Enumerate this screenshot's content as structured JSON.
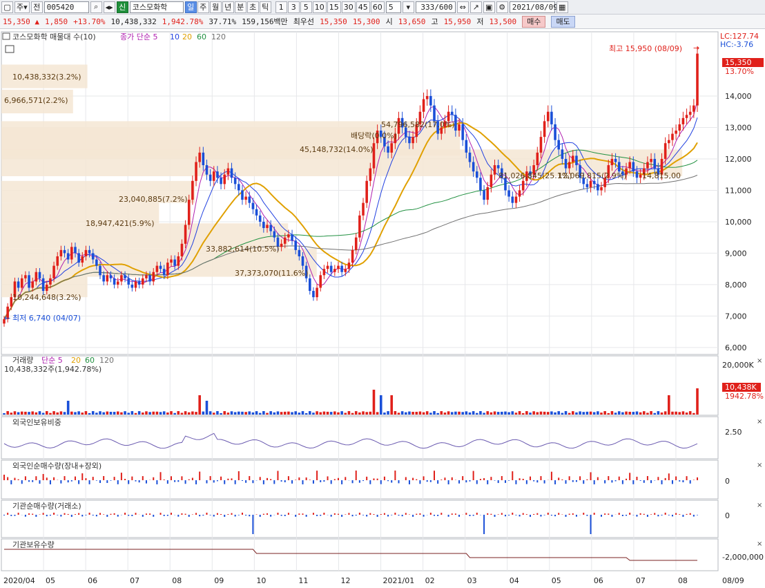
{
  "toolbar": {
    "market": "주",
    "prev": "전",
    "code": "005420",
    "mode_badge": "신",
    "stock_name": "코스모화학",
    "periods": [
      "일",
      "주",
      "월",
      "년",
      "분",
      "초",
      "틱"
    ],
    "active_period": "일",
    "intervals": [
      "1",
      "3",
      "5",
      "10",
      "15",
      "30",
      "45",
      "60"
    ],
    "count_box": "5",
    "range": "333/600",
    "date": "2021/08/09"
  },
  "quote": {
    "price": "15,350",
    "arrow": "▲",
    "change": "1,850",
    "change_pct": "+13.70%",
    "volume": "10,438,332",
    "volume_pct": "1,942.78%",
    "turnover": "37.71%",
    "amount": "159,156백만",
    "best_ask_label": "최우선",
    "best_ask": "15,350",
    "best_bid": "15,300",
    "open_label": "시",
    "open": "13,650",
    "high_label": "고",
    "high": "15,950",
    "low_label": "저",
    "low": "13,500",
    "buy": "매수",
    "sell": "매도"
  },
  "colors": {
    "up": "#e0201a",
    "down": "#1a4fd8",
    "ma5": "#b020b0",
    "ma10": "#2040e0",
    "ma20": "#e0a000",
    "ma60": "#209040",
    "ma120": "#707070",
    "box": "#f5e6d3"
  },
  "price_panel": {
    "legend_title": "코스모화학 매물대 수(10)",
    "legend_ma": "종가 단순 5",
    "legend_periods": [
      "10",
      "20",
      "60",
      "120"
    ],
    "lc": "LC:127.74",
    "hc": "HC:-3.76",
    "high_note": "최고 15,950 (08/09)",
    "low_note": "최저 6,740 (04/07)",
    "last_price": "15,350",
    "last_pct": "13.70%",
    "yticks": [
      "14,000",
      "13,000",
      "12,000",
      "11,000",
      "10,000",
      "9,000",
      "8,000",
      "7,000",
      "6,000"
    ],
    "profile": [
      "10,438,332(3.2%)",
      "6,966,571(2.2%)",
      "54,796,582(17.0%)",
      "배당락(0.0%)",
      "45,148,732(14.0%)",
      "81,026,845(25.1%)",
      "12,069,815(2.9%)",
      "14,815,00",
      "23,040,885(7.2%)",
      "18,947,421(5.9%)",
      "33,882,614(10.5%)",
      "37,373,070(11.6%)",
      "10,244,648(3.2%)"
    ]
  },
  "volume_panel": {
    "title": "거래량",
    "legend_ma": "단순 5",
    "legend_periods": [
      "20",
      "60",
      "120"
    ],
    "sub": "10,438,332주(1,942.78%)",
    "ytick": "20,000K",
    "last": "10,438K",
    "last_pct": "1942.78%"
  },
  "foreign_panel": {
    "title": "외국인보유비중",
    "ytick": "2.50"
  },
  "foreign_net_panel": {
    "title": "외국인순매수량(장내+장외)",
    "ytick": "0"
  },
  "inst_net_panel": {
    "title": "기관순매수량(거래소)",
    "ytick": "0"
  },
  "inst_hold_panel": {
    "title": "기관보유수량",
    "ytick": "-2,000,000"
  },
  "xaxis": [
    "2020/04",
    "05",
    "06",
    "07",
    "08",
    "09",
    "10",
    "11",
    "12",
    "2021/01",
    "02",
    "03",
    "04",
    "05",
    "06",
    "07",
    "08"
  ],
  "xaxis_end": "08/09",
  "chart_data": {
    "type": "candlestick",
    "ylim": [
      5800,
      16000
    ],
    "closes": [
      6900,
      7300,
      7600,
      8100,
      7900,
      8200,
      8300,
      7900,
      8100,
      8400,
      8200,
      7800,
      8000,
      8200,
      8600,
      8900,
      9100,
      9000,
      8800,
      9200,
      9000,
      8700,
      8900,
      9100,
      9000,
      8800,
      8600,
      8300,
      8100,
      8300,
      8200,
      8000,
      8100,
      8300,
      8200,
      8000,
      7900,
      8100,
      8000,
      8200,
      8300,
      8100,
      8400,
      8600,
      8500,
      8300,
      8700,
      8800,
      8600,
      8900,
      9300,
      9900,
      10700,
      11300,
      11900,
      12200,
      11800,
      11500,
      11300,
      11600,
      11400,
      11200,
      11500,
      11700,
      11400,
      11200,
      11000,
      10700,
      10800,
      10600,
      10400,
      10200,
      10000,
      9800,
      9900,
      9700,
      9500,
      9200,
      9300,
      9500,
      9600,
      9400,
      9100,
      8900,
      8600,
      8200,
      7800,
      7600,
      7900,
      8300,
      8500,
      8600,
      8400,
      8500,
      8600,
      8400,
      8500,
      8700,
      9100,
      9500,
      10200,
      10600,
      11300,
      11700,
      12500,
      12900,
      12700,
      12400,
      12200,
      12500,
      12800,
      13300,
      13000,
      12700,
      12500,
      12700,
      13100,
      13500,
      13900,
      14000,
      13700,
      13200,
      12800,
      13000,
      13200,
      13500,
      13400,
      12900,
      13100,
      12600,
      12200,
      11900,
      11600,
      11400,
      11000,
      10700,
      11100,
      11500,
      11800,
      11700,
      11400,
      11000,
      10800,
      10600,
      10800,
      11000,
      11300,
      11600,
      11500,
      11800,
      12200,
      12700,
      13200,
      13500,
      13100,
      12600,
      12300,
      12000,
      11700,
      11900,
      12100,
      11800,
      11400,
      11200,
      11100,
      11300,
      11200,
      11000,
      11100,
      11400,
      11800,
      12000,
      11900,
      11600,
      11500,
      11700,
      11900,
      11600,
      11400,
      11500,
      11700,
      11900,
      12000,
      11700,
      11500,
      12000,
      12500,
      12600,
      12800,
      12900,
      13100,
      13300,
      13400,
      13500,
      13700,
      15350
    ]
  }
}
